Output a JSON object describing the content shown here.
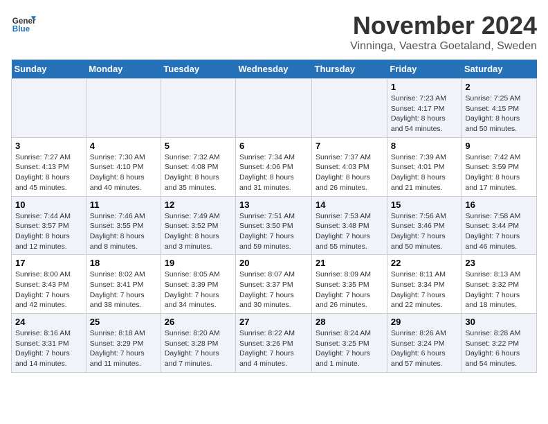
{
  "logo": {
    "text_general": "General",
    "text_blue": "Blue"
  },
  "header": {
    "title": "November 2024",
    "subtitle": "Vinninga, Vaestra Goetaland, Sweden"
  },
  "days_of_week": [
    "Sunday",
    "Monday",
    "Tuesday",
    "Wednesday",
    "Thursday",
    "Friday",
    "Saturday"
  ],
  "weeks": [
    [
      {
        "day": "",
        "info": ""
      },
      {
        "day": "",
        "info": ""
      },
      {
        "day": "",
        "info": ""
      },
      {
        "day": "",
        "info": ""
      },
      {
        "day": "",
        "info": ""
      },
      {
        "day": "1",
        "info": "Sunrise: 7:23 AM\nSunset: 4:17 PM\nDaylight: 8 hours and 54 minutes."
      },
      {
        "day": "2",
        "info": "Sunrise: 7:25 AM\nSunset: 4:15 PM\nDaylight: 8 hours and 50 minutes."
      }
    ],
    [
      {
        "day": "3",
        "info": "Sunrise: 7:27 AM\nSunset: 4:13 PM\nDaylight: 8 hours and 45 minutes."
      },
      {
        "day": "4",
        "info": "Sunrise: 7:30 AM\nSunset: 4:10 PM\nDaylight: 8 hours and 40 minutes."
      },
      {
        "day": "5",
        "info": "Sunrise: 7:32 AM\nSunset: 4:08 PM\nDaylight: 8 hours and 35 minutes."
      },
      {
        "day": "6",
        "info": "Sunrise: 7:34 AM\nSunset: 4:06 PM\nDaylight: 8 hours and 31 minutes."
      },
      {
        "day": "7",
        "info": "Sunrise: 7:37 AM\nSunset: 4:03 PM\nDaylight: 8 hours and 26 minutes."
      },
      {
        "day": "8",
        "info": "Sunrise: 7:39 AM\nSunset: 4:01 PM\nDaylight: 8 hours and 21 minutes."
      },
      {
        "day": "9",
        "info": "Sunrise: 7:42 AM\nSunset: 3:59 PM\nDaylight: 8 hours and 17 minutes."
      }
    ],
    [
      {
        "day": "10",
        "info": "Sunrise: 7:44 AM\nSunset: 3:57 PM\nDaylight: 8 hours and 12 minutes."
      },
      {
        "day": "11",
        "info": "Sunrise: 7:46 AM\nSunset: 3:55 PM\nDaylight: 8 hours and 8 minutes."
      },
      {
        "day": "12",
        "info": "Sunrise: 7:49 AM\nSunset: 3:52 PM\nDaylight: 8 hours and 3 minutes."
      },
      {
        "day": "13",
        "info": "Sunrise: 7:51 AM\nSunset: 3:50 PM\nDaylight: 7 hours and 59 minutes."
      },
      {
        "day": "14",
        "info": "Sunrise: 7:53 AM\nSunset: 3:48 PM\nDaylight: 7 hours and 55 minutes."
      },
      {
        "day": "15",
        "info": "Sunrise: 7:56 AM\nSunset: 3:46 PM\nDaylight: 7 hours and 50 minutes."
      },
      {
        "day": "16",
        "info": "Sunrise: 7:58 AM\nSunset: 3:44 PM\nDaylight: 7 hours and 46 minutes."
      }
    ],
    [
      {
        "day": "17",
        "info": "Sunrise: 8:00 AM\nSunset: 3:43 PM\nDaylight: 7 hours and 42 minutes."
      },
      {
        "day": "18",
        "info": "Sunrise: 8:02 AM\nSunset: 3:41 PM\nDaylight: 7 hours and 38 minutes."
      },
      {
        "day": "19",
        "info": "Sunrise: 8:05 AM\nSunset: 3:39 PM\nDaylight: 7 hours and 34 minutes."
      },
      {
        "day": "20",
        "info": "Sunrise: 8:07 AM\nSunset: 3:37 PM\nDaylight: 7 hours and 30 minutes."
      },
      {
        "day": "21",
        "info": "Sunrise: 8:09 AM\nSunset: 3:35 PM\nDaylight: 7 hours and 26 minutes."
      },
      {
        "day": "22",
        "info": "Sunrise: 8:11 AM\nSunset: 3:34 PM\nDaylight: 7 hours and 22 minutes."
      },
      {
        "day": "23",
        "info": "Sunrise: 8:13 AM\nSunset: 3:32 PM\nDaylight: 7 hours and 18 minutes."
      }
    ],
    [
      {
        "day": "24",
        "info": "Sunrise: 8:16 AM\nSunset: 3:31 PM\nDaylight: 7 hours and 14 minutes."
      },
      {
        "day": "25",
        "info": "Sunrise: 8:18 AM\nSunset: 3:29 PM\nDaylight: 7 hours and 11 minutes."
      },
      {
        "day": "26",
        "info": "Sunrise: 8:20 AM\nSunset: 3:28 PM\nDaylight: 7 hours and 7 minutes."
      },
      {
        "day": "27",
        "info": "Sunrise: 8:22 AM\nSunset: 3:26 PM\nDaylight: 7 hours and 4 minutes."
      },
      {
        "day": "28",
        "info": "Sunrise: 8:24 AM\nSunset: 3:25 PM\nDaylight: 7 hours and 1 minute."
      },
      {
        "day": "29",
        "info": "Sunrise: 8:26 AM\nSunset: 3:24 PM\nDaylight: 6 hours and 57 minutes."
      },
      {
        "day": "30",
        "info": "Sunrise: 8:28 AM\nSunset: 3:22 PM\nDaylight: 6 hours and 54 minutes."
      }
    ]
  ]
}
